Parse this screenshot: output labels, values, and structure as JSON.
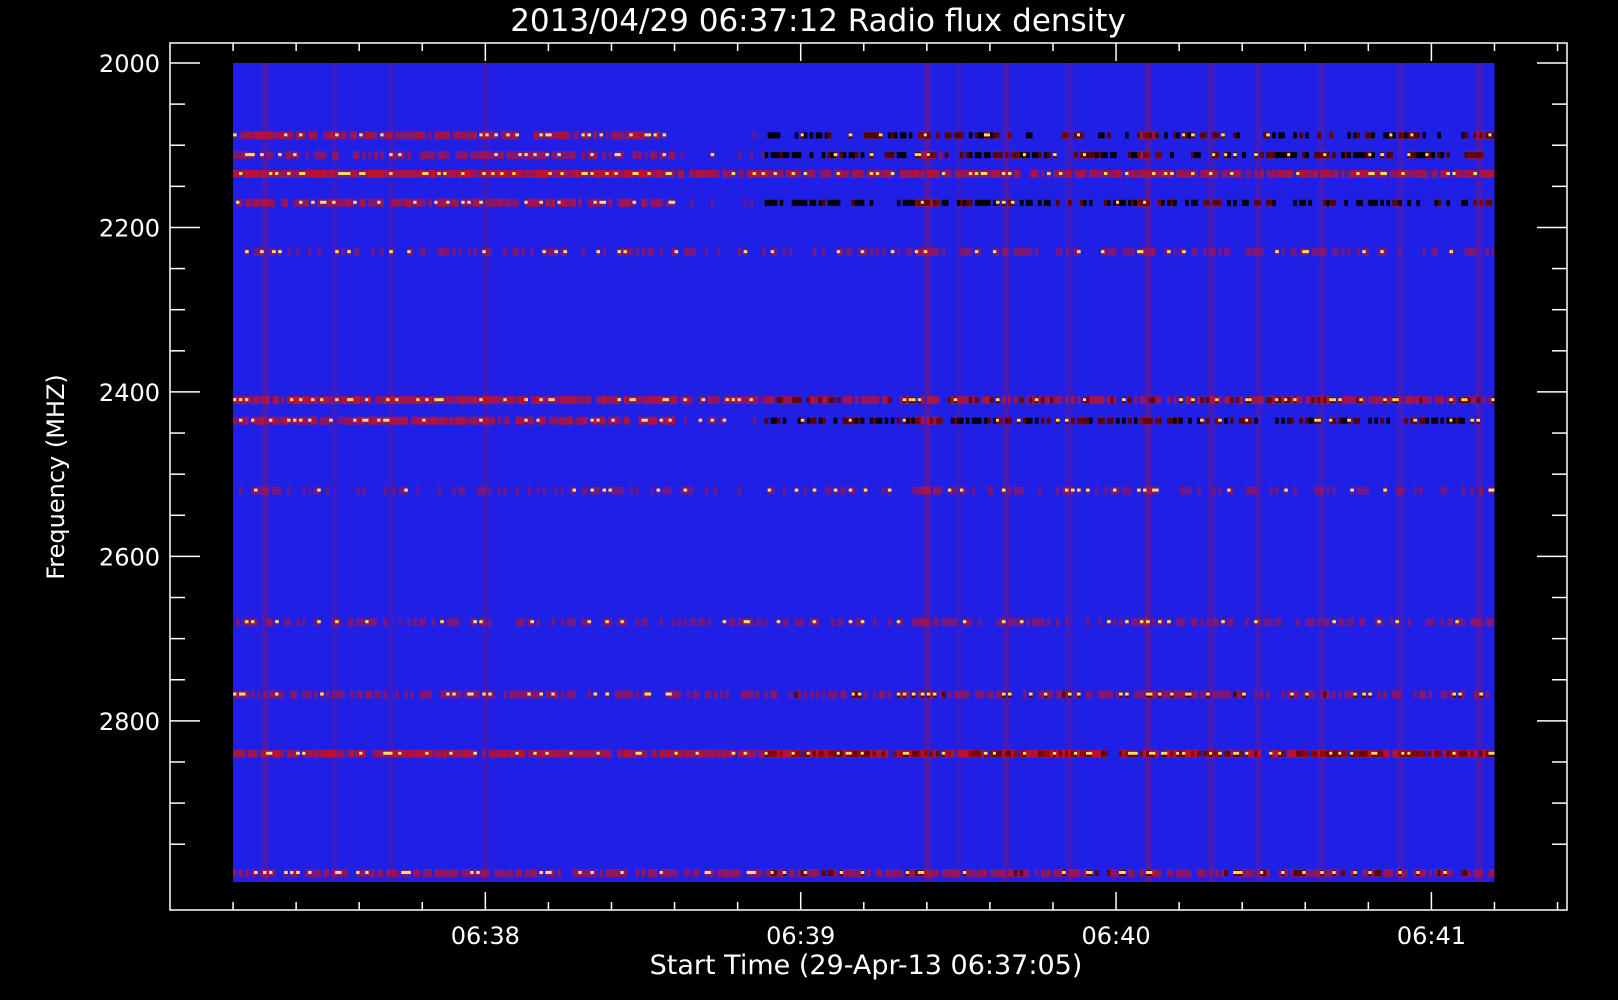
{
  "chart_data": {
    "type": "heatmap",
    "title": "2013/04/29 06:37:12 Radio flux density",
    "xlabel": "Start Time (29-Apr-13 06:37:05)",
    "ylabel": "Frequency (MHZ)",
    "x_unit": "minutes after 06:37:00",
    "xlim": [
      0.0,
      4.43
    ],
    "ylim": [
      2000,
      3030
    ],
    "data_x_range": [
      0.2,
      4.2
    ],
    "data_y_range": [
      2000,
      2996
    ],
    "x_ticks": [
      {
        "value": 1.0,
        "label": "06:38"
      },
      {
        "value": 2.0,
        "label": "06:39"
      },
      {
        "value": 3.0,
        "label": "06:40"
      },
      {
        "value": 4.0,
        "label": "06:41"
      }
    ],
    "y_ticks": [
      {
        "value": 2000,
        "label": "2000"
      },
      {
        "value": 2200,
        "label": "2200"
      },
      {
        "value": 2400,
        "label": "2400"
      },
      {
        "value": 2600,
        "label": "2600"
      },
      {
        "value": 2800,
        "label": "2800"
      }
    ],
    "colors": {
      "background": "#000000",
      "field": "#1f1fe6",
      "low": "#000000",
      "mid": "#d81010",
      "high": "#ffe060",
      "axis": "#ffffff"
    },
    "bands": [
      {
        "freq": 2088,
        "intensity": 0.85,
        "tail": 0.15,
        "dark_after": 0.7
      },
      {
        "freq": 2112,
        "intensity": 0.7,
        "tail": 0.2,
        "dark_after": 0.8
      },
      {
        "freq": 2135,
        "intensity": 1.0,
        "tail": 0.85,
        "dark_after": 0.0
      },
      {
        "freq": 2170,
        "intensity": 0.85,
        "tail": 0.1,
        "dark_after": 0.8
      },
      {
        "freq": 2230,
        "intensity": 0.45,
        "tail": 0.45,
        "dark_after": 0.0
      },
      {
        "freq": 2410,
        "intensity": 0.95,
        "tail": 0.8,
        "dark_after": 0.5
      },
      {
        "freq": 2435,
        "intensity": 0.85,
        "tail": 0.25,
        "dark_after": 0.8
      },
      {
        "freq": 2520,
        "intensity": 0.35,
        "tail": 0.35,
        "dark_after": 0.0
      },
      {
        "freq": 2680,
        "intensity": 0.5,
        "tail": 0.5,
        "dark_after": 0.0
      },
      {
        "freq": 2768,
        "intensity": 0.6,
        "tail": 0.6,
        "dark_after": 0.2
      },
      {
        "freq": 2840,
        "intensity": 0.9,
        "tail": 0.9,
        "dark_after": 0.9
      },
      {
        "freq": 2985,
        "intensity": 0.7,
        "tail": 0.7,
        "dark_after": 0.3
      }
    ],
    "bursts": [
      {
        "time": 0.3,
        "intensity": 0.6
      },
      {
        "time": 0.52,
        "intensity": 0.35
      },
      {
        "time": 0.7,
        "intensity": 0.35
      },
      {
        "time": 1.0,
        "intensity": 0.4
      },
      {
        "time": 2.4,
        "intensity": 0.75
      },
      {
        "time": 2.5,
        "intensity": 0.3
      },
      {
        "time": 2.65,
        "intensity": 0.6
      },
      {
        "time": 2.85,
        "intensity": 0.5
      },
      {
        "time": 3.1,
        "intensity": 0.75
      },
      {
        "time": 3.3,
        "intensity": 0.55
      },
      {
        "time": 3.45,
        "intensity": 0.45
      },
      {
        "time": 3.65,
        "intensity": 0.45
      },
      {
        "time": 3.9,
        "intensity": 0.45
      },
      {
        "time": 4.15,
        "intensity": 0.6
      }
    ]
  }
}
